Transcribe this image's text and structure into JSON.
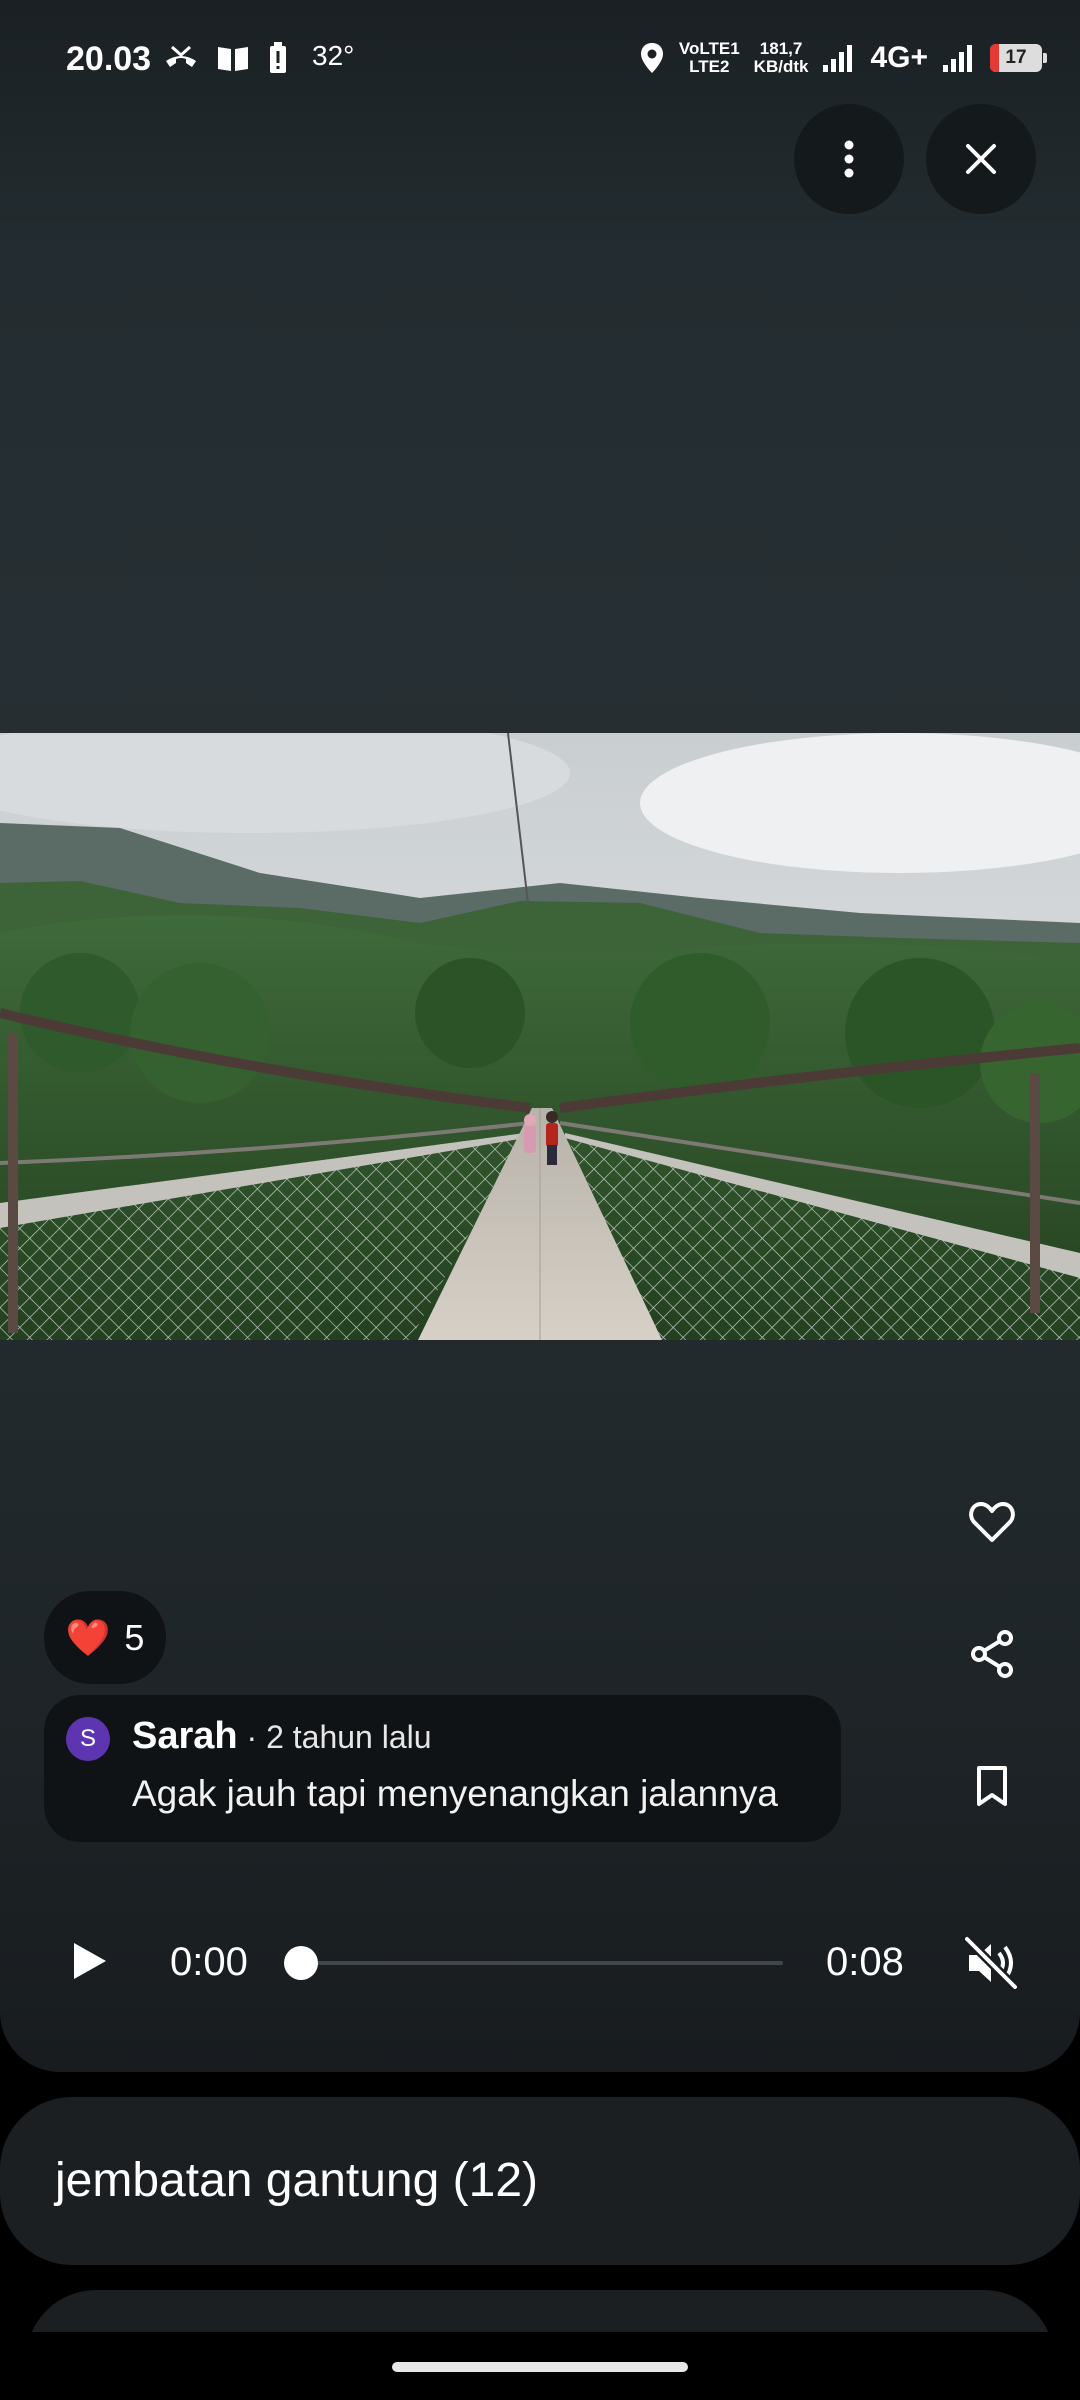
{
  "status_bar": {
    "time": "20.03",
    "temperature": "32°",
    "volte_line1": "VoLTE1",
    "volte_line2": "LTE2",
    "speed_line1": "181,7",
    "speed_line2": "KB/dtk",
    "network": "4G+",
    "battery": "17",
    "battery_level_percent": 17,
    "icons": [
      "missed-call-icon",
      "book-icon",
      "battery-alert-icon",
      "location-icon",
      "signal-icon",
      "signal-icon"
    ]
  },
  "toolbar": {
    "more_icon": "more-vert-icon",
    "close_icon": "close-icon"
  },
  "reaction": {
    "emoji": "❤️",
    "count": "5"
  },
  "comment": {
    "avatar_letter": "S",
    "author": "Sarah",
    "time": " · 2 tahun lalu",
    "text": "Agak jauh tapi menyenangkan jalannya"
  },
  "actions": [
    "favorite-icon",
    "share-icon",
    "bookmark-icon"
  ],
  "player": {
    "current_time": "0:00",
    "duration": "0:08",
    "progress_fraction": 0,
    "muted": true
  },
  "album": {
    "title": "jembatan gantung (12)"
  },
  "colors": {
    "avatar": "#5e35b1",
    "card_bg": "#0f1315",
    "album_bg": "#1b1f22",
    "battery_low": "#e53935"
  }
}
